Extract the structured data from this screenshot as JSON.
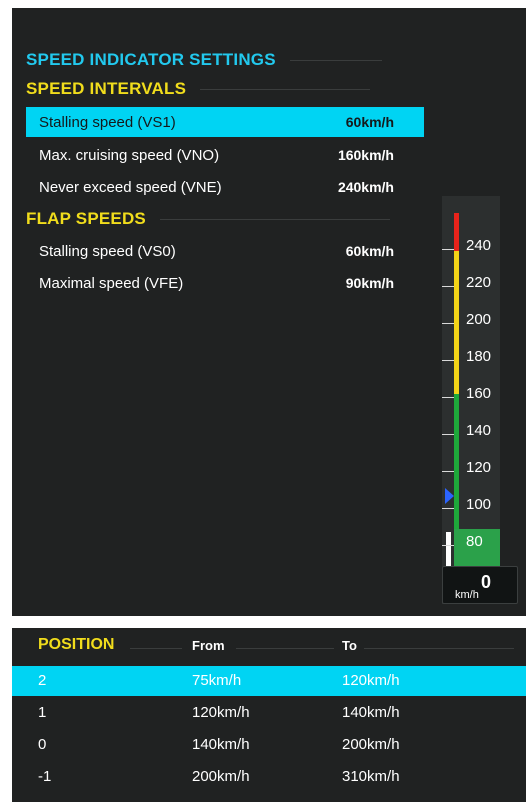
{
  "settings": {
    "title": "SPEED INDICATOR SETTINGS",
    "intervals": {
      "title": "SPEED INTERVALS",
      "items": [
        {
          "label": "Stalling speed (VS1)",
          "value": "60km/h"
        },
        {
          "label": "Max. cruising speed (VNO)",
          "value": "160km/h"
        },
        {
          "label": "Never exceed speed (VNE)",
          "value": "240km/h"
        }
      ]
    },
    "flaps": {
      "title": "FLAP SPEEDS",
      "items": [
        {
          "label": "Stalling speed (VS0)",
          "value": "60km/h"
        },
        {
          "label": "Maximal speed (VFE)",
          "value": "90km/h"
        }
      ]
    }
  },
  "gauge": {
    "ticks": [
      "240",
      "220",
      "200",
      "180",
      "160",
      "140",
      "120",
      "100",
      "80"
    ],
    "readout": "0",
    "unit": "km/h",
    "colors": {
      "red": "#e8231b",
      "yellow": "#f3d417",
      "green": "#1ea83a",
      "pointer": "#2b64ff"
    }
  },
  "flap_table": {
    "headers": {
      "position": "POSITION",
      "from": "From",
      "to": "To"
    },
    "rows": [
      {
        "position": "2",
        "from": "75km/h",
        "to": "120km/h"
      },
      {
        "position": "1",
        "from": "120km/h",
        "to": "140km/h"
      },
      {
        "position": "0",
        "from": "140km/h",
        "to": "200km/h"
      },
      {
        "position": "-1",
        "from": "200km/h",
        "to": "310km/h"
      }
    ]
  },
  "accent": "#00d4f3"
}
